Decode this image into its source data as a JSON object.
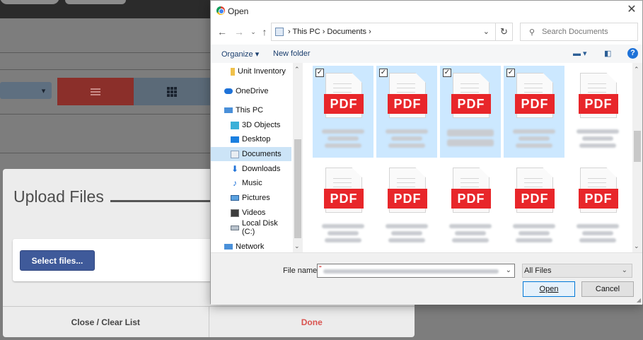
{
  "upload": {
    "title": "Upload Files",
    "select_files": "Select files...",
    "close_clear": "Close / Clear List",
    "done": "Done"
  },
  "background": {
    "dropdown_arrow": "▾",
    "list_view_icon": "list-icon",
    "grid_view_icon": "grid-icon"
  },
  "dialog": {
    "title": "Open",
    "address": {
      "segments": [
        "This PC",
        "Documents"
      ],
      "text": "› This PC › Documents ›"
    },
    "search_placeholder": "Search Documents",
    "commands": {
      "organize": "Organize ▾",
      "new_folder": "New folder"
    },
    "nav_items": [
      {
        "label": "Unit Inventory",
        "icon": "folder-icon"
      },
      {
        "label": "OneDrive",
        "icon": "cloud-icon"
      },
      {
        "label": "This PC",
        "icon": "computer-icon"
      },
      {
        "label": "3D Objects",
        "icon": "cube-icon"
      },
      {
        "label": "Desktop",
        "icon": "desktop-icon"
      },
      {
        "label": "Documents",
        "icon": "documents-icon",
        "selected": true
      },
      {
        "label": "Downloads",
        "icon": "download-icon"
      },
      {
        "label": "Music",
        "icon": "music-icon"
      },
      {
        "label": "Pictures",
        "icon": "pictures-icon"
      },
      {
        "label": "Videos",
        "icon": "videos-icon"
      },
      {
        "label": "Local Disk (C:)",
        "icon": "disk-icon"
      },
      {
        "label": "Network",
        "icon": "network-icon"
      }
    ],
    "files": [
      {
        "type": "PDF",
        "selected": true
      },
      {
        "type": "PDF",
        "selected": true
      },
      {
        "type": "PDF",
        "selected": true
      },
      {
        "type": "PDF",
        "selected": true
      },
      {
        "type": "PDF",
        "selected": false
      },
      {
        "type": "PDF",
        "selected": false
      },
      {
        "type": "PDF",
        "selected": false
      },
      {
        "type": "PDF",
        "selected": false
      },
      {
        "type": "PDF",
        "selected": false
      },
      {
        "type": "PDF",
        "selected": false
      }
    ],
    "filename_label": "File name:",
    "filter_value": "All Files",
    "open_button": "Open",
    "cancel_button": "Cancel"
  },
  "colors": {
    "accent": "#0078d7",
    "pdf_red": "#e8262a",
    "selection": "#cce8ff",
    "done_red": "#d9534f",
    "select_files_blue": "#3f5a9a"
  }
}
